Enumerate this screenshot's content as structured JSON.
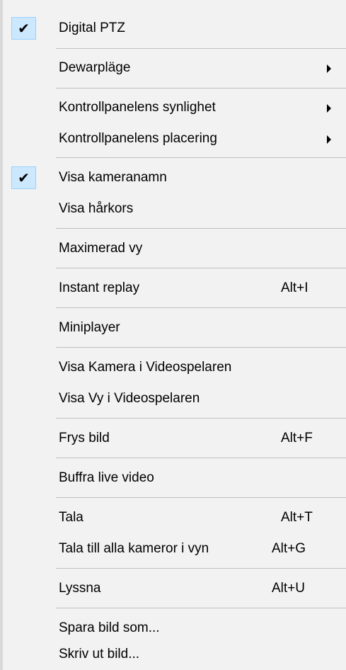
{
  "menu": {
    "items": [
      {
        "label": "Digital PTZ",
        "checked": true
      },
      {
        "label": "Dewarpläge",
        "submenu": true
      },
      {
        "label": "Kontrollpanelens synlighet",
        "submenu": true
      },
      {
        "label": "Kontrollpanelens placering",
        "submenu": true
      },
      {
        "label": "Visa kameranamn",
        "checked": true
      },
      {
        "label": "Visa hårkors"
      },
      {
        "label": "Maximerad vy"
      },
      {
        "label": "Instant replay",
        "shortcut": "Alt+I"
      },
      {
        "label": "Miniplayer"
      },
      {
        "label": "Visa Kamera i Videospelaren"
      },
      {
        "label": "Visa Vy i Videospelaren"
      },
      {
        "label": "Frys bild",
        "shortcut": "Alt+F"
      },
      {
        "label": "Buffra live video"
      },
      {
        "label": "Tala",
        "shortcut": "Alt+T"
      },
      {
        "label": "Tala till alla kameror i vyn",
        "shortcut": "Alt+G"
      },
      {
        "label": "Lyssna",
        "shortcut": "Alt+U"
      },
      {
        "label": "Spara bild som..."
      },
      {
        "label": "Skriv ut bild..."
      }
    ],
    "check_glyph": "✔",
    "colors": {
      "background": "#f2f2f2",
      "check_highlight": "#cce8ff",
      "check_border": "#99d1ff",
      "separator": "#bfbfbf"
    }
  }
}
